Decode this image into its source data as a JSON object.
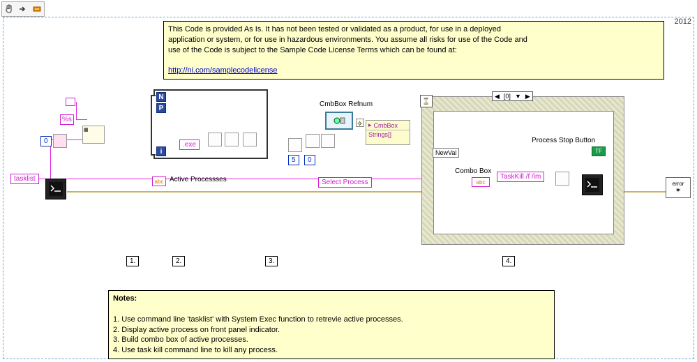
{
  "toolbar": {
    "hand_icon": "hand-icon",
    "arrow_icon": "arrow-icon",
    "break_icon": "break-icon"
  },
  "year": "2012",
  "disclaimer": {
    "line1": " This Code is provided As Is.  It has not been tested or validated as a product, for use in a deployed",
    "line2": "  application or system, or for use in hazardous environments.  You assume all risks for use of the Code and",
    "line3": " use of the Code is subject to the Sample Code License Terms which can be found at:",
    "link": "http://ni.com/samplecodelicense"
  },
  "constants": {
    "tasklist": "tasklist",
    "zero": "0",
    "percent_s": "%s",
    "exe": ".exe",
    "five": "5",
    "zero2": "0",
    "taskkill": "TaskKill /f /im"
  },
  "labels": {
    "active_processes": "Active Processses",
    "cmbbox_refnum": "CmbBox Refnum",
    "select_process": "Select Process",
    "process_stop_button": "Process Stop Button",
    "combo_box": "Combo Box",
    "newval": "NewVal",
    "error": "error",
    "cmbbox": "CmbBox",
    "strings": "Strings[]"
  },
  "event": {
    "idx": "[0]"
  },
  "steps": {
    "s1": "1.",
    "s2": "2.",
    "s3": "3.",
    "s4": "4."
  },
  "notes": {
    "title": "Notes:",
    "n1": "1. Use command line 'tasklist' with System Exec function to retrevie active processes.",
    "n2": "2.  Display active process on front panel indicator.",
    "n3": "3.  Build combo box of active processes.",
    "n4": "4. Use task kill command line to kill any process."
  }
}
